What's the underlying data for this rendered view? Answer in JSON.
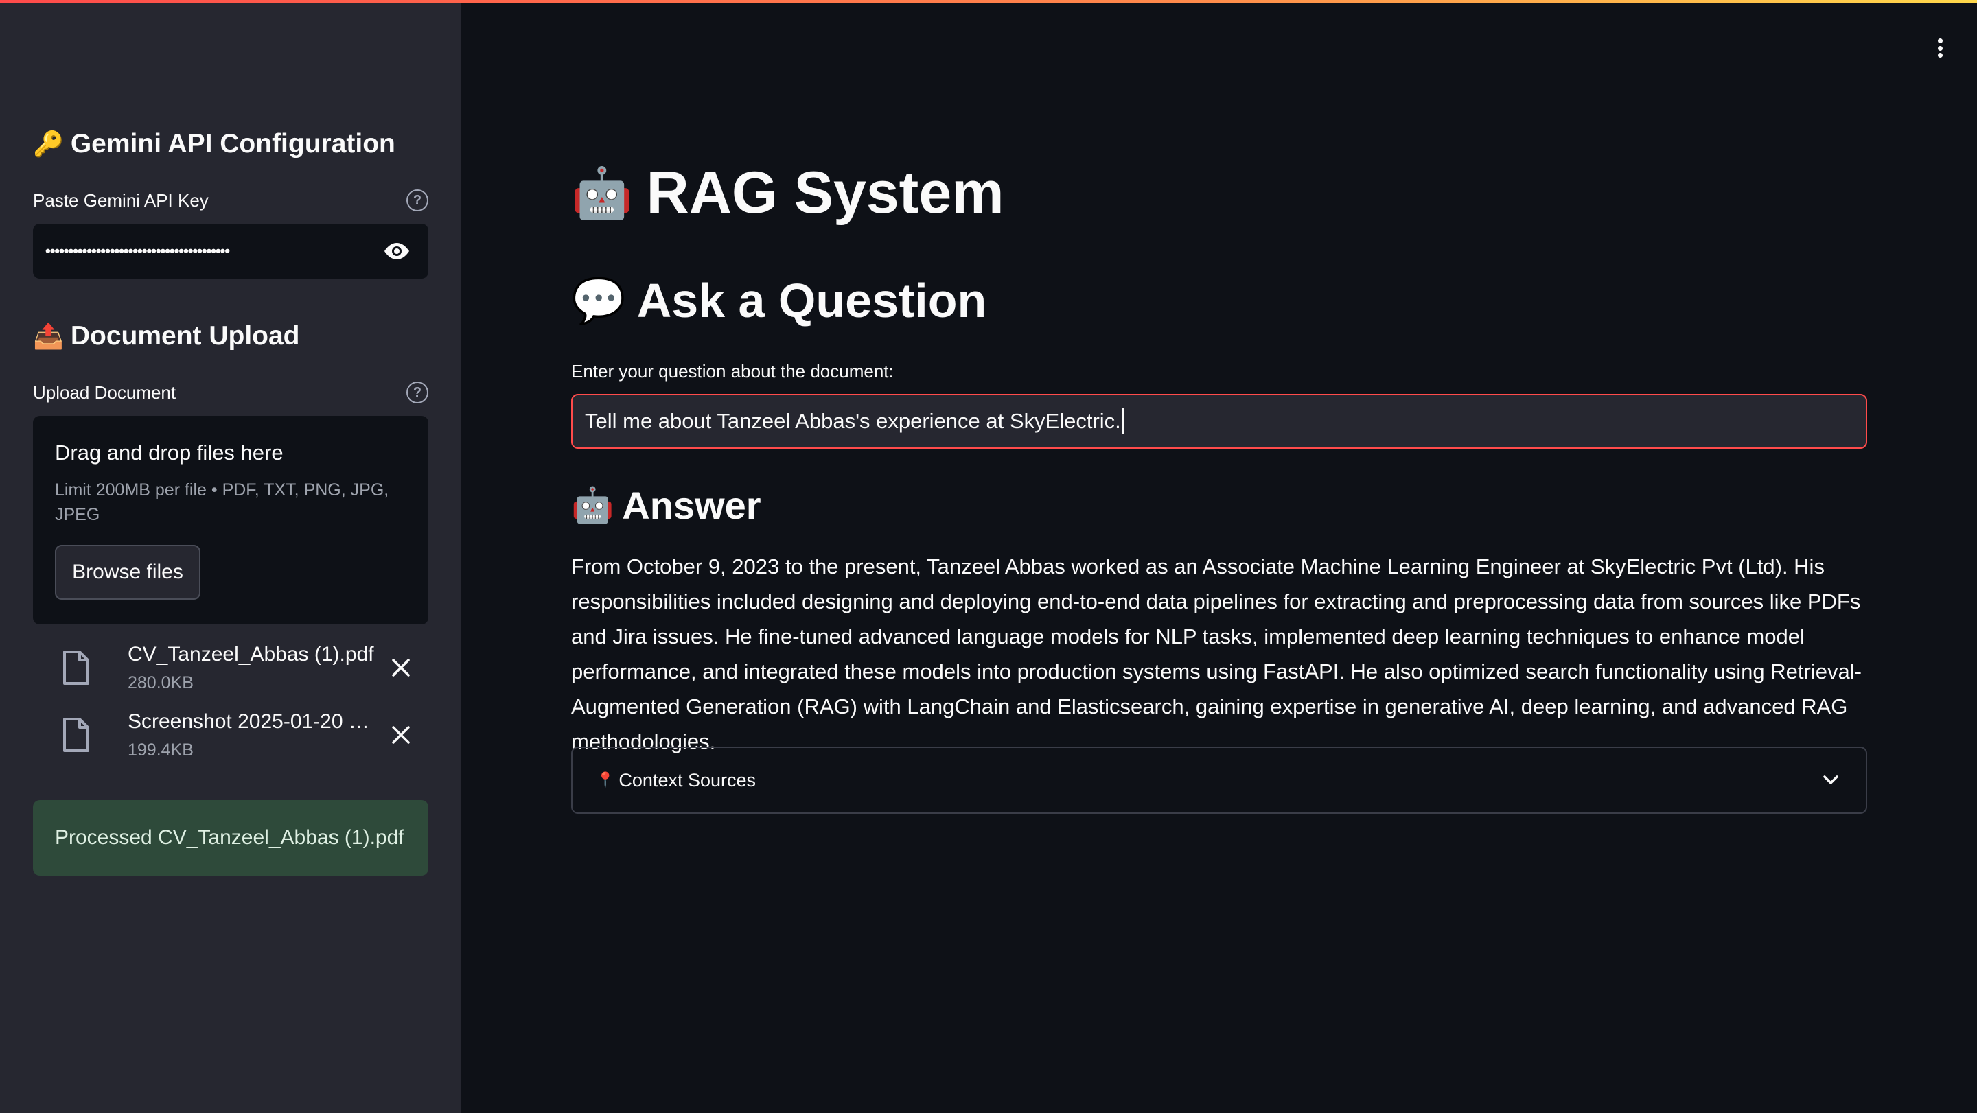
{
  "sidebar": {
    "api_section": {
      "emoji": "🔑",
      "title": "Gemini API Configuration",
      "field_label": "Paste Gemini API Key",
      "masked_value": "••••••••••••••••••••••••••••••••••••••••"
    },
    "upload_section": {
      "emoji": "📤",
      "title": "Document Upload",
      "field_label": "Upload Document",
      "dropzone_title": "Drag and drop files here",
      "dropzone_limit": "Limit 200MB per file • PDF, TXT, PNG, JPG, JPEG",
      "browse_label": "Browse files"
    },
    "files": [
      {
        "name": "CV_Tanzeel_Abbas (1).pdf",
        "size": "280.0KB"
      },
      {
        "name": "Screenshot 2025-01-20 a...",
        "size": "199.4KB"
      }
    ],
    "success_message": "Processed CV_Tanzeel_Abbas (1).pdf"
  },
  "main": {
    "title_emoji": "🤖",
    "title": "RAG System",
    "ask_emoji": "💬",
    "ask_heading": "Ask a Question",
    "question_label": "Enter your question about the document:",
    "question_value": "Tell me about Tanzeel Abbas's experience at SkyElectric.",
    "answer_emoji": "🤖",
    "answer_heading": "Answer",
    "answer_text": "From October 9, 2023 to the present, Tanzeel Abbas worked as an Associate Machine Learning Engineer at SkyElectric Pvt (Ltd). His responsibilities included designing and deploying end-to-end data pipelines for extracting and preprocessing data from sources like PDFs and Jira issues. He fine-tuned advanced language models for NLP tasks, implemented deep learning techniques to enhance model performance, and integrated these models into production systems using FastAPI. He also optimized search functionality using Retrieval-Augmented Generation (RAG) with LangChain and Elasticsearch, gaining expertise in generative AI, deep learning, and advanced RAG methodologies.",
    "context_emoji": "📍",
    "context_label": "Context Sources"
  },
  "colors": {
    "background": "#0e1117",
    "sidebar": "#262730",
    "accent": "#ff4b4b",
    "success_bg": "#2e4a3a"
  },
  "icons": {
    "help": "help-circle-icon",
    "eye": "eye-icon",
    "file": "file-icon",
    "close": "close-icon",
    "chevron": "chevron-down-icon",
    "menu": "kebab-menu-icon"
  }
}
